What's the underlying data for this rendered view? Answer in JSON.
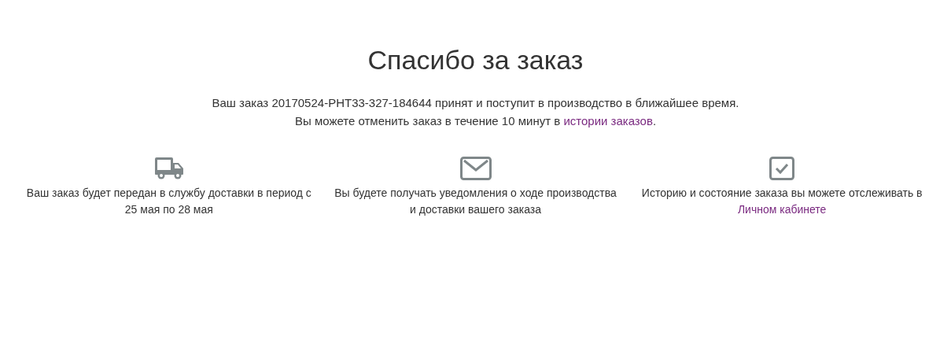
{
  "title": "Спасибо за заказ",
  "message": [
    {
      "text": "Ваш заказ 20170524-PHT33-327-184644 принят и поступит в производство в ближайшее время."
    },
    {
      "text": "Вы можете отменить заказ в течение 10 минут в ",
      "link": "истории заказов",
      "after": "."
    }
  ],
  "features": [
    {
      "text": "Ваш заказ будет передан в службу доставки в период с 25 мая по 28 мая"
    },
    {
      "text": "Вы будете получать уведомления о ходе производства и доставки вашего заказа"
    },
    {
      "text": "Историю и состояние заказа вы можете отслеживать в ",
      "link": "Личном кабинете"
    }
  ]
}
